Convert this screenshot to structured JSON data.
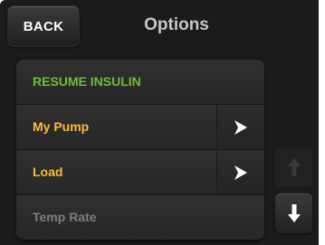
{
  "header": {
    "back_label": "BACK",
    "title": "Options"
  },
  "menu": {
    "items": [
      {
        "label": "RESUME INSULIN",
        "color": "#67c13a",
        "has_arrow": false,
        "enabled": true
      },
      {
        "label": "My Pump",
        "color": "#ffb83a",
        "has_arrow": true,
        "enabled": true
      },
      {
        "label": "Load",
        "color": "#ffb83a",
        "has_arrow": true,
        "enabled": true
      },
      {
        "label": "Temp Rate",
        "color": "#7d7d7d",
        "has_arrow": false,
        "enabled": false
      }
    ]
  },
  "scroll": {
    "up_icon": "arrow-up-icon",
    "up_enabled": false,
    "down_icon": "arrow-down-icon",
    "down_enabled": true
  }
}
